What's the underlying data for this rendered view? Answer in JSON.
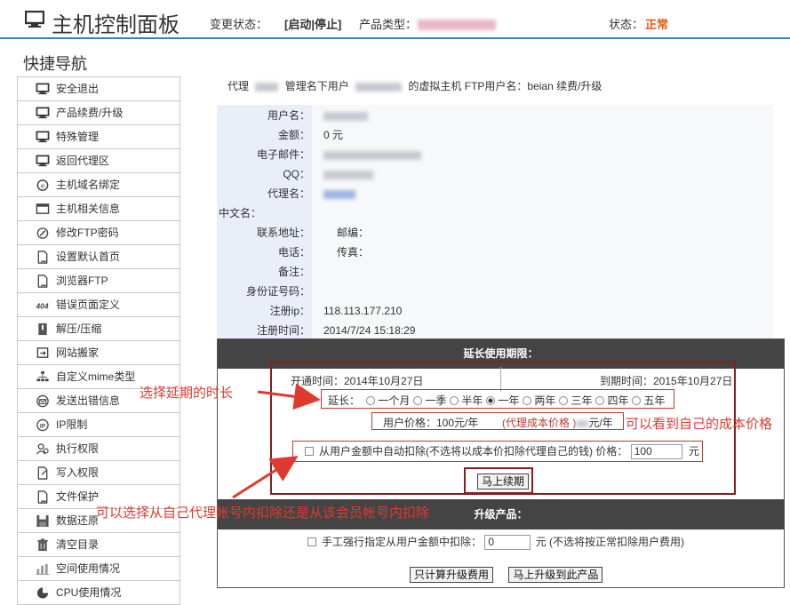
{
  "header": {
    "title": "主机控制面板",
    "change_status_label": "变更状态：",
    "change_status_actions": "[启动|停止]",
    "product_type_label": "产品类型：",
    "status_label": "状态：",
    "status_value": "正常"
  },
  "sidebar": {
    "title": "快捷导航",
    "items": [
      {
        "label": "安全退出",
        "icon": "monitor-icon"
      },
      {
        "label": "产品续费/升级",
        "icon": "monitor-icon"
      },
      {
        "label": "特殊管理",
        "icon": "monitor-icon"
      },
      {
        "label": "返回代理区",
        "icon": "monitor-icon"
      },
      {
        "label": "主机域名绑定",
        "icon": "domain-icon"
      },
      {
        "label": "主机相关信息",
        "icon": "info-window-icon"
      },
      {
        "label": "修改FTP密码",
        "icon": "edit-icon"
      },
      {
        "label": "设置默认首页",
        "icon": "page-icon"
      },
      {
        "label": "浏览器FTP",
        "icon": "page-icon"
      },
      {
        "label": "错误页面定义",
        "icon": "404-icon"
      },
      {
        "label": "解压/压缩",
        "icon": "archive-icon"
      },
      {
        "label": "网站搬家",
        "icon": "move-icon"
      },
      {
        "label": "自定义mime类型",
        "icon": "sitemap-icon"
      },
      {
        "label": "发送出错信息",
        "icon": "mail-icon"
      },
      {
        "label": "IP限制",
        "icon": "ip-icon"
      },
      {
        "label": "执行权限",
        "icon": "execute-icon"
      },
      {
        "label": "写入权限",
        "icon": "write-icon"
      },
      {
        "label": "文件保护",
        "icon": "page-icon"
      },
      {
        "label": "数据还原",
        "icon": "save-icon"
      },
      {
        "label": "清空目录",
        "icon": "trash-icon"
      },
      {
        "label": "空间使用情况",
        "icon": "chart-icon"
      },
      {
        "label": "CPU使用情况",
        "icon": "pie-icon"
      }
    ]
  },
  "intro": {
    "prefix": "代理",
    "middle": "管理名下用户",
    "suffix": "的虚拟主机 FTP用户名：beian 续费/升级"
  },
  "account": {
    "username_label": "用户名：",
    "balance_label": "金额：",
    "balance_value": "0 元",
    "email_label": "电子邮件：",
    "qq_label": "QQ：",
    "agent_label": "代理名：",
    "cn_name_label": "中文名：",
    "address_label": "联系地址：",
    "zipcode_label": "邮编：",
    "phone_label": "电话：",
    "fax_label": "传真：",
    "note_label": "备注：",
    "id_label": "身份证号码：",
    "reg_ip_label": "注册ip：",
    "reg_ip_value": "118.113.177.210",
    "reg_time_label": "注册时间：",
    "reg_time_value": "2014/7/24 15:18:29"
  },
  "renew": {
    "header": "延长使用期限：",
    "open_time": "开通时间：2014年10月27日",
    "expire_time": "到期时间：2015年10月27日",
    "period_label": "延长：",
    "periods": [
      "一个月",
      "一季",
      "半年",
      "一年",
      "两年",
      "三年",
      "四年",
      "五年"
    ],
    "selected_period": "一年",
    "user_price": "用户价格：100元/年",
    "cost_price_prefix": "(代理成本价格 )",
    "cost_price_suffix": "元/年",
    "auto_deduct_label": "从用户金额中自动扣除(不选将以成本价扣除代理自己的钱) 价格：",
    "price_value": "100",
    "price_unit": "元",
    "renew_button": "马上续期"
  },
  "upgrade": {
    "header": "升级产品：",
    "force_deduct_label": "手工强行指定从用户金额中扣除：",
    "deduct_value": "0",
    "deduct_hint": "元 (不选将按正常扣除用户费用)",
    "calc_button": "只计算升级费用",
    "upgrade_button": "马上升级到此产品"
  },
  "annotations": {
    "choose_period": "选择延期的时长",
    "see_cost": "可以看到自己的成本价格",
    "choose_account": "可以选择从自己代理帐号内扣除还是从该会员帐号内扣除"
  },
  "colors": {
    "accent": "#3a7fc1",
    "status_ok": "#e8590c",
    "panel_header": "#444444",
    "annotation": "#e03a2f",
    "box": "#8b1d1d"
  }
}
